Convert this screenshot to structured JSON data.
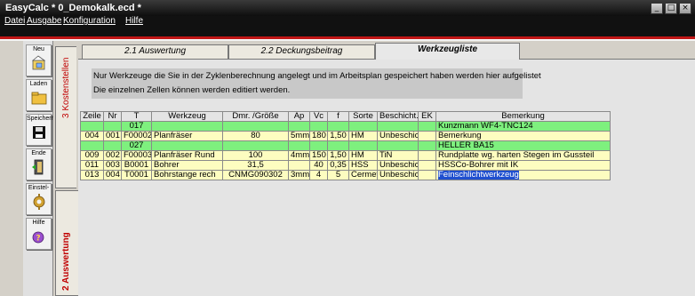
{
  "window": {
    "title": "EasyCalc * 0_Demokalk.ecd *",
    "controls": [
      "_",
      "□",
      "×"
    ]
  },
  "menu": [
    "Datei",
    "Ausgabe",
    "Konfiguration",
    "Hilfe"
  ],
  "toolbar": {
    "buttons": [
      {
        "label": "Neu",
        "icon": "new-file-icon"
      },
      {
        "label": "Laden",
        "icon": "folder-icon"
      },
      {
        "label": "Speichern",
        "icon": "floppy-icon"
      },
      {
        "label": "Ende",
        "icon": "door-exit-icon"
      },
      {
        "label": "Einstel-",
        "icon": "settings-icon"
      },
      {
        "label": "Hilfe",
        "icon": "help-icon"
      }
    ]
  },
  "side_tabs": [
    {
      "label": "3 Kostenstellen"
    },
    {
      "label": "2 Auswertung"
    }
  ],
  "tabs": [
    {
      "label": "2.1 Auswertung"
    },
    {
      "label": "2.2 Deckungsbeitrag"
    },
    {
      "label": "Werkzeugliste"
    }
  ],
  "info": {
    "line1": "Nur Werkzeuge die Sie in der Zyklenberechnung angelegt und im Arbeitsplan gespeichert haben werden hier aufgelistet",
    "line2": "Die einzelnen Zellen können werden editiert werden."
  },
  "grid": {
    "columns": [
      "Zeile",
      "Nr",
      "T",
      "Werkzeug",
      "Dmr. /Größe",
      "Ap",
      "Vc",
      "f",
      "Sorte",
      "Beschicht.",
      "EK",
      "Bemerkung"
    ],
    "rows": [
      {
        "type": "green",
        "cells": [
          "",
          "",
          "017",
          "",
          "",
          "",
          "",
          "",
          "",
          "",
          "",
          "Kunzmann WF4-TNC124"
        ]
      },
      {
        "type": "yellow",
        "cells": [
          "004",
          "001",
          "F00002",
          "Planfräser",
          "80",
          "5mm",
          "180",
          "1,50",
          "HM",
          "Unbeschich",
          "",
          "Bemerkung"
        ]
      },
      {
        "type": "green",
        "cells": [
          "",
          "",
          "027",
          "",
          "",
          "",
          "",
          "",
          "",
          "",
          "",
          "HELLER BA15"
        ]
      },
      {
        "type": "yellow",
        "cells": [
          "009",
          "002",
          "F00003",
          "Planfräser Rund",
          "100",
          "4mm",
          "150",
          "1,50",
          "HM",
          "TiN",
          "",
          "Rundplatte wg. harten Stegen im Gussteil"
        ]
      },
      {
        "type": "yellow",
        "cells": [
          "011",
          "003",
          "B0001",
          "Bohrer",
          "31,5",
          "",
          "40",
          "0,35",
          "HSS",
          "Unbeschich",
          "",
          "HSSCo-Bohrer mit IK"
        ]
      },
      {
        "type": "yellow",
        "cells": [
          "013",
          "004",
          "T0001",
          "Bohrstange rech",
          "CNMG090302",
          "3mm",
          "4",
          "5",
          "Cermet",
          "Unbeschich",
          "",
          "Feinschlichtwerkzeug"
        ]
      }
    ]
  }
}
